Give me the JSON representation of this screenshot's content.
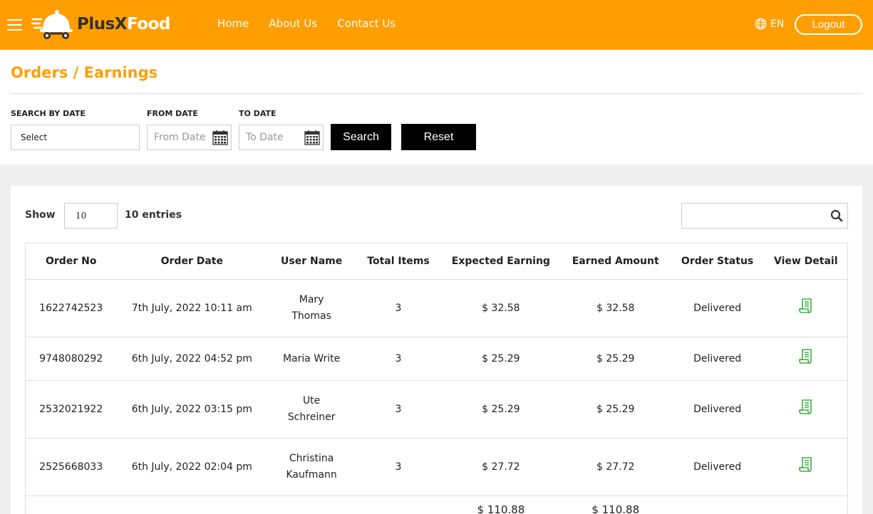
{
  "header": {
    "brand_part1": "PlusX",
    "brand_part2": "Food",
    "nav": [
      "Home",
      "About Us",
      "Contact Us"
    ],
    "language": "EN",
    "logout_label": "Logout",
    "accent_color": "#ff9e02"
  },
  "page": {
    "title": "Orders / Earnings"
  },
  "filters": {
    "search_by_date_label": "SEARCH BY DATE",
    "search_by_date_value": "Select",
    "from_date_label": "FROM DATE",
    "from_date_placeholder": "From Date",
    "to_date_label": "TO DATE",
    "to_date_placeholder": "To Date",
    "search_button": "Search",
    "reset_button": "Reset"
  },
  "table_controls": {
    "show_label": "Show",
    "entries_value": "10",
    "entries_label": "10 entries"
  },
  "table": {
    "columns": [
      "Order No",
      "Order Date",
      "User Name",
      "Total Items",
      "Expected Earning",
      "Earned Amount",
      "Order Status",
      "View Detail"
    ],
    "rows": [
      {
        "order_no": "1622742523",
        "order_date": "7th July, 2022 10:11 am",
        "user_name_1": "Mary",
        "user_name_2": "Thomas",
        "total_items": "3",
        "expected_earning": "$ 32.58",
        "earned_amount": "$ 32.58",
        "status": "Delivered"
      },
      {
        "order_no": "9748080292",
        "order_date": "6th July, 2022 04:52 pm",
        "user_name_1": "Maria Write",
        "user_name_2": "",
        "total_items": "3",
        "expected_earning": "$ 25.29",
        "earned_amount": "$ 25.29",
        "status": "Delivered"
      },
      {
        "order_no": "2532021922",
        "order_date": "6th July, 2022 03:15 pm",
        "user_name_1": "Ute",
        "user_name_2": "Schreiner",
        "total_items": "3",
        "expected_earning": "$ 25.29",
        "earned_amount": "$ 25.29",
        "status": "Delivered"
      },
      {
        "order_no": "2525668033",
        "order_date": "6th July, 2022 02:04 pm",
        "user_name_1": "Christina",
        "user_name_2": "Kaufmann",
        "total_items": "3",
        "expected_earning": "$ 27.72",
        "earned_amount": "$ 27.72",
        "status": "Delivered"
      }
    ],
    "totals": {
      "expected_earning": "$ 110.88",
      "earned_amount": "$ 110.88"
    },
    "view_icon_color": "#3cb043"
  }
}
